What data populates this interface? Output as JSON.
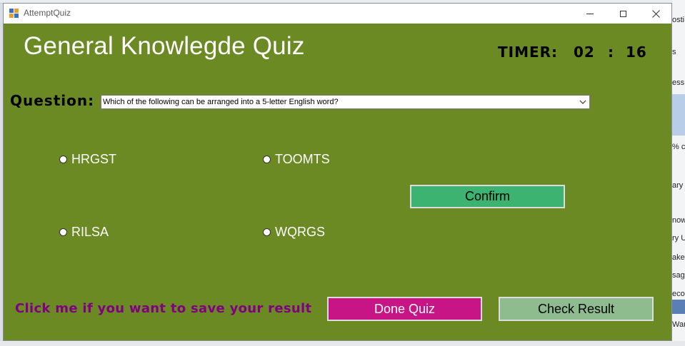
{
  "window": {
    "title": "AttemptQuiz"
  },
  "quiz": {
    "heading": "General Knowlegde Quiz",
    "timer_label": "TIMER:",
    "timer_minutes": "02",
    "timer_separator": ":",
    "timer_seconds": "16",
    "question_label": "Question:",
    "question_text": "Which of the following can be arranged into a 5-letter English word?",
    "options": [
      "HRGST",
      "TOOMTS",
      "RILSA",
      "WQRGS"
    ],
    "confirm_label": "Confirm",
    "save_link_text": "Click me if you want to save your result",
    "done_label": "Done Quiz",
    "check_label": "Check Result"
  },
  "colors": {
    "background": "#6b8a23",
    "confirm": "#3cb371",
    "done": "#c71585",
    "check": "#8fbc8f",
    "save_link": "#800080"
  },
  "background_fragments": {
    "right": [
      "osti",
      "s",
      "ess",
      "% c",
      "ary",
      "now",
      "ry U",
      "ake",
      "sag",
      "ecor",
      "War"
    ]
  }
}
